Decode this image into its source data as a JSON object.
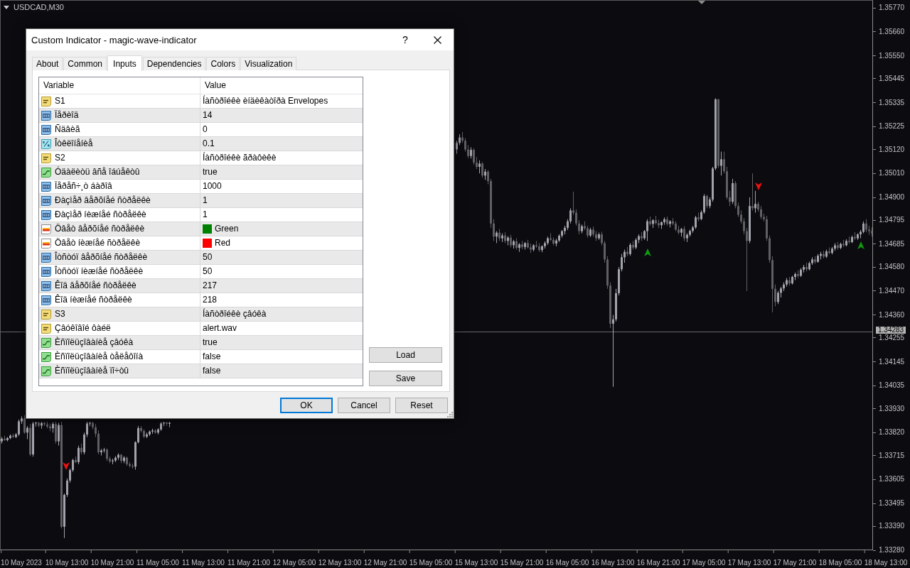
{
  "chart": {
    "symbol": "USDCAD,M30",
    "chart_data": {
      "type": "candlestick",
      "ylim": [
        1.3328,
        1.35806
      ],
      "yticks": [
        {
          "value": 1.3577,
          "label": "1.35770"
        },
        {
          "value": 1.3566,
          "label": "1.35660"
        },
        {
          "value": 1.3555,
          "label": "1.35550"
        },
        {
          "value": 1.35445,
          "label": "1.35445"
        },
        {
          "value": 1.35335,
          "label": "1.35335"
        },
        {
          "value": 1.35225,
          "label": "1.35225"
        },
        {
          "value": 1.3512,
          "label": "1.35120"
        },
        {
          "value": 1.3501,
          "label": "1.35010"
        },
        {
          "value": 1.349,
          "label": "1.34900"
        },
        {
          "value": 1.34795,
          "label": "1.34795"
        },
        {
          "value": 1.34685,
          "label": "1.34685"
        },
        {
          "value": 1.3458,
          "label": "1.34580"
        },
        {
          "value": 1.3447,
          "label": "1.34470"
        },
        {
          "value": 1.3436,
          "label": "1.34360"
        },
        {
          "value": 1.34255,
          "label": "1.34255"
        },
        {
          "value": 1.34145,
          "label": "1.34145"
        },
        {
          "value": 1.34035,
          "label": "1.34035"
        },
        {
          "value": 1.3393,
          "label": "1.33930"
        },
        {
          "value": 1.3382,
          "label": "1.33820"
        },
        {
          "value": 1.33715,
          "label": "1.33715"
        },
        {
          "value": 1.33605,
          "label": "1.33605"
        },
        {
          "value": 1.33495,
          "label": "1.33495"
        },
        {
          "value": 1.3339,
          "label": "1.33390"
        },
        {
          "value": 1.3328,
          "label": "1.33280"
        }
      ],
      "ref_lines": [
        {
          "axis": "y",
          "value": 1.34283,
          "label": "1.34283"
        }
      ],
      "categories": [
        null,
        null,
        null,
        null,
        null,
        null,
        null,
        "10 May 2023",
        null,
        null,
        null,
        null,
        null,
        null,
        null,
        null,
        null,
        null,
        null,
        null,
        null,
        null,
        null,
        "10 May 13:00",
        null,
        null,
        null,
        null,
        null,
        null,
        null,
        null,
        null,
        null,
        null,
        null,
        null,
        null,
        null,
        "10 May 21:00",
        null,
        null,
        null,
        null,
        null,
        null,
        null,
        null,
        null,
        null,
        null,
        null,
        null,
        null,
        null,
        "11 May 05:00",
        null,
        null,
        null,
        null,
        null,
        null,
        null,
        null,
        null,
        null,
        null,
        null,
        null,
        null,
        null,
        "11 May 13:00",
        null,
        null,
        null,
        null,
        null,
        null,
        null,
        null,
        null,
        null,
        null,
        null,
        null,
        null,
        null,
        "11 May 21:00",
        null,
        null,
        null,
        null,
        null,
        null,
        null,
        null,
        null,
        null,
        null,
        null,
        null,
        null,
        null,
        "12 May 05:00",
        null,
        null,
        null,
        null,
        null,
        null,
        null,
        null,
        null,
        null,
        null,
        null,
        null,
        null,
        null,
        "12 May 13:00",
        null,
        null,
        null,
        null,
        null,
        null,
        null,
        null,
        null,
        null,
        null,
        null,
        null,
        null,
        null,
        "12 May 21:00",
        null,
        null,
        null,
        null,
        null,
        null,
        null,
        null,
        null,
        null,
        null,
        null,
        null,
        null,
        null,
        "15 May 05:00",
        null,
        null,
        null,
        null,
        null,
        null,
        null,
        null,
        null,
        null,
        null,
        null,
        null,
        null,
        null,
        "15 May 13:00",
        null,
        null,
        null,
        null,
        null,
        null,
        null,
        null,
        null,
        null,
        null,
        null,
        null,
        null,
        null,
        "15 May 21:00",
        null,
        null,
        null,
        null,
        null,
        null,
        null,
        null,
        null,
        null,
        null,
        null,
        null,
        null,
        null,
        "16 May 05:00",
        null,
        null,
        null,
        null,
        null,
        null,
        null,
        null,
        null,
        null,
        null,
        null,
        null,
        null,
        null,
        "16 May 13:00",
        null,
        null,
        null,
        null,
        null,
        null,
        null,
        null,
        null,
        null,
        null,
        null,
        null,
        null,
        null,
        "16 May 21:00",
        null,
        null,
        null,
        null,
        null,
        null,
        null,
        null,
        null,
        null,
        null,
        null,
        null,
        null,
        null,
        "17 May 05:00",
        null,
        null,
        null,
        null,
        null,
        null,
        null,
        null,
        null,
        null,
        null,
        null,
        null,
        null,
        null,
        "17 May 13:00",
        null,
        null,
        null,
        null,
        null,
        null,
        null,
        null,
        null,
        null,
        null,
        null,
        null,
        null,
        null,
        "17 May 21:00",
        null,
        null,
        null,
        null,
        null,
        null,
        null,
        null,
        null,
        null,
        null,
        null,
        null,
        null,
        null,
        "18 May 05:00",
        null,
        null,
        null,
        null,
        null,
        null,
        null,
        null,
        null,
        null,
        null,
        null,
        null,
        null,
        null,
        "18 May 13:00",
        null,
        null
      ],
      "ohlc": [
        [
          1.3378,
          1.338,
          1.3377,
          1.33792
        ],
        [
          1.33792,
          1.33805,
          1.33782,
          1.33786
        ],
        [
          1.33786,
          1.338,
          1.3378,
          1.33795
        ],
        [
          1.33795,
          1.33812,
          1.3379,
          1.33806
        ],
        [
          1.33806,
          1.33815,
          1.33796,
          1.338
        ],
        [
          1.338,
          1.33818,
          1.33795,
          1.33812
        ],
        [
          1.33812,
          1.3388,
          1.33805,
          1.33872
        ],
        [
          1.33872,
          1.33895,
          1.3386,
          1.33885
        ],
        [
          1.33885,
          1.339,
          1.33815,
          1.3382
        ],
        [
          1.3382,
          1.3385,
          1.3379,
          1.33842
        ],
        [
          1.33842,
          1.3386,
          1.33712,
          1.3372
        ],
        [
          1.3372,
          1.3387,
          1.3371,
          1.33862
        ],
        [
          1.33862,
          1.3387,
          1.33848,
          1.33866
        ],
        [
          1.33866,
          1.3387,
          1.33845,
          1.33852
        ],
        [
          1.33852,
          1.3387,
          1.33838,
          1.33864
        ],
        [
          1.33864,
          1.3387,
          1.3385,
          1.33858
        ],
        [
          1.33858,
          1.3387,
          1.3384,
          1.33848
        ],
        [
          1.33848,
          1.33862,
          1.33826,
          1.3384
        ],
        [
          1.3384,
          1.33868,
          1.3382,
          1.3386
        ],
        [
          1.3386,
          1.3387,
          1.3377,
          1.3378
        ],
        [
          1.3378,
          1.33865,
          1.3376,
          1.33855
        ],
        [
          1.33855,
          1.3387,
          1.3338,
          1.33388
        ],
        [
          1.33388,
          1.3354,
          1.33336,
          1.33534
        ],
        [
          1.33534,
          1.3361,
          1.33525,
          1.336
        ],
        [
          1.336,
          1.33655,
          1.3359,
          1.33648
        ],
        [
          1.33648,
          1.337,
          1.3364,
          1.33694
        ],
        [
          1.33694,
          1.3371,
          1.3368,
          1.33685
        ],
        [
          1.33685,
          1.3376,
          1.33675,
          1.3375
        ],
        [
          1.3375,
          1.3377,
          1.3372,
          1.3373
        ],
        [
          1.3373,
          1.3382,
          1.3372,
          1.33811
        ],
        [
          1.33811,
          1.3387,
          1.338,
          1.33862
        ],
        [
          1.33862,
          1.3387,
          1.3385,
          1.33865
        ],
        [
          1.33865,
          1.3387,
          1.33835,
          1.33845
        ],
        [
          1.33845,
          1.3386,
          1.338,
          1.33815
        ],
        [
          1.33815,
          1.3383,
          1.3372,
          1.3373
        ],
        [
          1.3373,
          1.33745,
          1.33715,
          1.33738
        ],
        [
          1.33738,
          1.3375,
          1.33728,
          1.33742
        ],
        [
          1.33742,
          1.33748,
          1.3369,
          1.337
        ],
        [
          1.337,
          1.3371,
          1.3368,
          1.33688
        ],
        [
          1.33688,
          1.337,
          1.33675,
          1.33692
        ],
        [
          1.33692,
          1.33712,
          1.33685,
          1.33705
        ],
        [
          1.33705,
          1.33725,
          1.33695,
          1.33718
        ],
        [
          1.33718,
          1.33722,
          1.3368,
          1.3369
        ],
        [
          1.3369,
          1.33712,
          1.3368,
          1.33705
        ],
        [
          1.33705,
          1.3371,
          1.33668,
          1.33675
        ],
        [
          1.33675,
          1.33685,
          1.3366,
          1.33668
        ],
        [
          1.33668,
          1.33678,
          1.33655,
          1.33664
        ],
        [
          1.33664,
          1.3378,
          1.3365,
          1.33776
        ],
        [
          1.33776,
          1.3385,
          1.3377,
          1.33841
        ],
        [
          1.33841,
          1.3385,
          1.3382,
          1.33828
        ],
        [
          1.33828,
          1.33835,
          1.33795,
          1.33802
        ],
        [
          1.33802,
          1.3382,
          1.33795,
          1.33812
        ],
        [
          1.33812,
          1.3383,
          1.33805,
          1.33825
        ],
        [
          1.33825,
          1.33838,
          1.33815,
          1.3383
        ],
        [
          1.3383,
          1.33836,
          1.33815,
          1.3382
        ],
        [
          1.3382,
          1.3384,
          1.33812,
          1.33835
        ],
        [
          1.33835,
          1.33868,
          1.33828,
          1.33862
        ],
        [
          1.33862,
          1.3387,
          1.3385,
          1.33866
        ],
        [
          1.33866,
          1.3387,
          1.33852,
          1.3386
        ],
        [
          1.3386,
          1.3387,
          1.33845,
          1.33865
        ],
        null,
        null,
        null,
        null,
        null,
        null,
        null,
        null,
        null,
        null,
        null,
        null,
        null,
        null,
        null,
        null,
        null,
        null,
        null,
        null,
        null,
        null,
        null,
        null,
        null,
        null,
        null,
        null,
        null,
        null,
        null,
        null,
        null,
        null,
        null,
        null,
        null,
        null,
        null,
        null,
        null,
        null,
        null,
        null,
        null,
        null,
        null,
        null,
        null,
        null,
        null,
        null,
        null,
        null,
        null,
        null,
        null,
        null,
        null,
        null,
        null,
        null,
        null,
        null,
        null,
        null,
        null,
        null,
        null,
        null,
        null,
        null,
        null,
        null,
        null,
        null,
        null,
        null,
        null,
        null,
        null,
        null,
        null,
        null,
        null,
        null,
        null,
        null,
        null,
        null,
        null,
        null,
        null,
        null,
        null,
        null,
        null,
        null,
        null,
        null,
        [
          1.3512,
          1.3516,
          1.351,
          1.3515
        ],
        [
          1.3515,
          1.3519,
          1.3514,
          1.35175
        ],
        [
          1.35175,
          1.352,
          1.3515,
          1.3516
        ],
        [
          1.3516,
          1.35172,
          1.3511,
          1.3512
        ],
        [
          1.3512,
          1.3514,
          1.3508,
          1.3509
        ],
        [
          1.3509,
          1.3513,
          1.35078,
          1.35118
        ],
        [
          1.35118,
          1.35125,
          1.3505,
          1.3506
        ],
        [
          1.3506,
          1.35085,
          1.3503,
          1.3504
        ],
        [
          1.3504,
          1.3507,
          1.3501,
          1.35055
        ],
        [
          1.35055,
          1.35062,
          1.3499,
          1.35
        ],
        [
          1.35,
          1.3503,
          1.3498,
          1.35018
        ],
        [
          1.35018,
          1.35025,
          1.3496,
          1.34975
        ],
        [
          1.34975,
          1.34985,
          1.3476,
          1.3478
        ],
        [
          1.3478,
          1.348,
          1.347,
          1.3472
        ],
        [
          1.3472,
          1.34745,
          1.3469,
          1.34738
        ],
        [
          1.34738,
          1.34755,
          1.347,
          1.34712
        ],
        [
          1.34712,
          1.34735,
          1.34695,
          1.34725
        ],
        [
          1.34725,
          1.3474,
          1.3469,
          1.347
        ],
        [
          1.347,
          1.34722,
          1.3468,
          1.34715
        ],
        [
          1.34715,
          1.34728,
          1.3467,
          1.3468
        ],
        [
          1.3468,
          1.34705,
          1.34665,
          1.34698
        ],
        [
          1.34698,
          1.34712,
          1.3466,
          1.34668
        ],
        [
          1.34668,
          1.3469,
          1.3465,
          1.34684
        ],
        [
          1.34684,
          1.347,
          1.34662,
          1.34672
        ],
        [
          1.34672,
          1.34695,
          1.3466,
          1.3469
        ],
        [
          1.3469,
          1.34705,
          1.34665,
          1.3467
        ],
        [
          1.3467,
          1.34688,
          1.34645,
          1.3466
        ],
        [
          1.3466,
          1.34685,
          1.34652,
          1.3468
        ],
        [
          1.3468,
          1.347,
          1.34668,
          1.34675
        ],
        [
          1.34675,
          1.3469,
          1.3465,
          1.34658
        ],
        [
          1.34658,
          1.3468,
          1.34648,
          1.34676
        ],
        [
          1.34676,
          1.34698,
          1.34665,
          1.3469
        ],
        [
          1.3469,
          1.3472,
          1.34682,
          1.34712
        ],
        [
          1.34712,
          1.34735,
          1.347,
          1.34705
        ],
        [
          1.34705,
          1.34716,
          1.3468,
          1.34688
        ],
        [
          1.34688,
          1.3471,
          1.34675,
          1.34702
        ],
        [
          1.34702,
          1.3473,
          1.34695,
          1.34724
        ],
        [
          1.34724,
          1.3475,
          1.34715,
          1.34745
        ],
        [
          1.34745,
          1.3477,
          1.3473,
          1.3476
        ],
        [
          1.3476,
          1.348,
          1.3475,
          1.3479
        ],
        [
          1.3479,
          1.3485,
          1.3478,
          1.3484
        ],
        [
          1.3484,
          1.34926,
          1.3482,
          1.3483
        ],
        [
          1.3483,
          1.34845,
          1.3477,
          1.3478
        ],
        [
          1.3478,
          1.34795,
          1.3473,
          1.34745
        ],
        [
          1.34745,
          1.34775,
          1.34735,
          1.34768
        ],
        [
          1.34768,
          1.3479,
          1.3475,
          1.34758
        ],
        [
          1.34758,
          1.3477,
          1.34715,
          1.34725
        ],
        [
          1.34725,
          1.3476,
          1.34718,
          1.34752
        ],
        [
          1.34752,
          1.34766,
          1.3472,
          1.3473
        ],
        [
          1.3473,
          1.34745,
          1.347,
          1.34712
        ],
        [
          1.34712,
          1.34738,
          1.34705,
          1.3473
        ],
        [
          1.3473,
          1.34742,
          1.3468,
          1.3469
        ],
        [
          1.3469,
          1.347,
          1.346,
          1.34615
        ],
        [
          1.34615,
          1.3463,
          1.3448,
          1.34495
        ],
        [
          1.34495,
          1.3451,
          1.343,
          1.3432
        ],
        [
          1.3432,
          1.3436,
          1.3403,
          1.3434
        ],
        [
          1.3434,
          1.3448,
          1.3433,
          1.3446
        ],
        [
          1.3446,
          1.3458,
          1.3445,
          1.3457
        ],
        [
          1.3457,
          1.3464,
          1.3456,
          1.34625
        ],
        [
          1.34625,
          1.3466,
          1.346,
          1.3465
        ],
        [
          1.3465,
          1.34672,
          1.3463,
          1.3464
        ],
        [
          1.3464,
          1.3469,
          1.34632,
          1.34682
        ],
        [
          1.34682,
          1.347,
          1.3466,
          1.3467
        ],
        [
          1.3467,
          1.34712,
          1.34662,
          1.34705
        ],
        [
          1.34705,
          1.3473,
          1.3469,
          1.34722
        ],
        [
          1.34722,
          1.3474,
          1.347,
          1.34712
        ],
        [
          1.34712,
          1.3475,
          1.34705,
          1.34745
        ],
        [
          1.34745,
          1.348,
          1.347,
          1.3479
        ],
        [
          1.3479,
          1.34812,
          1.3477,
          1.34778
        ],
        [
          1.34778,
          1.348,
          1.3476,
          1.34795
        ],
        [
          1.34795,
          1.34815,
          1.34775,
          1.34782
        ],
        [
          1.34782,
          1.34798,
          1.3476,
          1.34772
        ],
        [
          1.34772,
          1.3479,
          1.34755,
          1.34786
        ],
        [
          1.34786,
          1.34808,
          1.34774,
          1.348
        ],
        [
          1.348,
          1.34812,
          1.3477,
          1.34778
        ],
        [
          1.34778,
          1.34795,
          1.34762,
          1.3479
        ],
        [
          1.3479,
          1.34805,
          1.34772,
          1.3478
        ],
        [
          1.3478,
          1.3479,
          1.34745,
          1.34752
        ],
        [
          1.34752,
          1.3477,
          1.3473,
          1.34738
        ],
        [
          1.34738,
          1.3476,
          1.3472,
          1.34755
        ],
        [
          1.34755,
          1.34768,
          1.347,
          1.34712
        ],
        [
          1.34712,
          1.34735,
          1.34695,
          1.34728
        ],
        [
          1.34728,
          1.34752,
          1.3472,
          1.34746
        ],
        [
          1.34746,
          1.3477,
          1.34738,
          1.34762
        ],
        [
          1.34762,
          1.34815,
          1.34755,
          1.34808
        ],
        [
          1.34808,
          1.3483,
          1.3479,
          1.348
        ],
        [
          1.348,
          1.3484,
          1.34795,
          1.34832
        ],
        [
          1.34832,
          1.34915,
          1.34825,
          1.34906
        ],
        [
          1.34906,
          1.34912,
          1.3485,
          1.3486
        ],
        [
          1.3486,
          1.349,
          1.3485,
          1.3489
        ],
        [
          1.3489,
          1.3504,
          1.3488,
          1.35033
        ],
        [
          1.35033,
          1.35355,
          1.35025,
          1.3535
        ],
        [
          1.3535,
          1.35352,
          1.35035,
          1.35045
        ],
        [
          1.35045,
          1.3511,
          1.35,
          1.35075
        ],
        [
          1.35075,
          1.3511,
          1.3501,
          1.3502
        ],
        [
          1.3502,
          1.3504,
          1.3489,
          1.349
        ],
        [
          1.349,
          1.3493,
          1.3486,
          1.3488
        ],
        [
          1.3488,
          1.34985,
          1.3487,
          1.34965
        ],
        [
          1.34965,
          1.34975,
          1.3485,
          1.3486
        ],
        [
          1.3486,
          1.34875,
          1.3481,
          1.3482
        ],
        [
          1.3482,
          1.3484,
          1.3478,
          1.3479
        ],
        [
          1.3479,
          1.34805,
          1.3473,
          1.34745
        ],
        [
          1.34745,
          1.3476,
          1.3447,
          1.347
        ],
        [
          1.347,
          1.349,
          1.3469,
          1.3486
        ],
        [
          1.3486,
          1.3501,
          1.3484,
          1.3485
        ],
        [
          1.3485,
          1.3493,
          1.3483,
          1.3487
        ],
        [
          1.3487,
          1.3488,
          1.34835,
          1.34845
        ],
        [
          1.34845,
          1.3486,
          1.348,
          1.3481
        ],
        [
          1.3481,
          1.34825,
          1.3479,
          1.348
        ],
        [
          1.348,
          1.34815,
          1.347,
          1.34712
        ],
        [
          1.34712,
          1.34725,
          1.346,
          1.34612
        ],
        [
          1.34612,
          1.3463,
          1.34372,
          1.3448
        ],
        [
          1.3448,
          1.345,
          1.344,
          1.3442
        ],
        [
          1.3442,
          1.3447,
          1.3441,
          1.34462
        ],
        [
          1.34462,
          1.3449,
          1.3444,
          1.34482
        ],
        [
          1.34482,
          1.3451,
          1.3447,
          1.345
        ],
        [
          1.345,
          1.3453,
          1.3449,
          1.3452
        ],
        [
          1.3452,
          1.34535,
          1.34495,
          1.34505
        ],
        [
          1.34505,
          1.3454,
          1.345,
          1.34535
        ],
        [
          1.34535,
          1.34555,
          1.3452,
          1.34548
        ],
        [
          1.34548,
          1.34565,
          1.3453,
          1.3454
        ],
        [
          1.3454,
          1.34575,
          1.34535,
          1.34568
        ],
        [
          1.34568,
          1.3459,
          1.34555,
          1.3458
        ],
        [
          1.3458,
          1.346,
          1.3456,
          1.3457
        ],
        [
          1.3457,
          1.34605,
          1.34565,
          1.34598
        ],
        [
          1.34598,
          1.34625,
          1.3459,
          1.34615
        ],
        [
          1.34615,
          1.3463,
          1.34595,
          1.34604
        ],
        [
          1.34604,
          1.3464,
          1.346,
          1.34632
        ],
        [
          1.34632,
          1.3465,
          1.34615,
          1.3464
        ],
        [
          1.3464,
          1.34655,
          1.3462,
          1.34628
        ],
        [
          1.34628,
          1.3466,
          1.34622,
          1.34652
        ],
        [
          1.34652,
          1.3467,
          1.3464,
          1.34645
        ],
        [
          1.34645,
          1.34672,
          1.34638,
          1.34665
        ],
        [
          1.34665,
          1.3469,
          1.34655,
          1.3468
        ],
        [
          1.3468,
          1.34695,
          1.3466,
          1.34668
        ],
        [
          1.34668,
          1.34692,
          1.34662,
          1.34686
        ],
        [
          1.34686,
          1.34705,
          1.34672,
          1.3468
        ],
        [
          1.3468,
          1.34708,
          1.34675,
          1.347
        ],
        [
          1.347,
          1.3472,
          1.34688,
          1.34695
        ],
        [
          1.34695,
          1.34725,
          1.3469,
          1.34718
        ],
        [
          1.34718,
          1.3474,
          1.34705,
          1.34712
        ],
        [
          1.34712,
          1.34735,
          1.34705,
          1.3473
        ],
        [
          1.3473,
          1.3475,
          1.34712,
          1.34742
        ],
        [
          1.34742,
          1.3479,
          1.34735,
          1.3478
        ],
        [
          1.3478,
          1.348,
          1.3474,
          1.34752
        ],
        [
          1.34752,
          1.3477,
          1.34728,
          1.34745
        ],
        [
          1.34745,
          1.34762,
          1.3472,
          1.34735
        ],
        null,
        null,
        null,
        null,
        null,
        null,
        null
      ]
    }
  },
  "dialog": {
    "title": "Custom Indicator - magic-wave-indicator",
    "help": "?",
    "tabs": [
      {
        "label": "About",
        "selected": false
      },
      {
        "label": "Common",
        "selected": false
      },
      {
        "label": "Inputs",
        "selected": true
      },
      {
        "label": "Dependencies",
        "selected": false
      },
      {
        "label": "Colors",
        "selected": false
      },
      {
        "label": "Visualization",
        "selected": false
      }
    ],
    "table": {
      "columns": [
        "Variable",
        "Value"
      ],
      "rows": [
        {
          "kind": "string",
          "name": "S1",
          "value": "Íàñòðîéêè èíäèêàòîðà Envelopes"
        },
        {
          "kind": "int",
          "name": "Ïåðèîä",
          "value": "14"
        },
        {
          "kind": "int",
          "name": "Ñäâèã",
          "value": "0"
        },
        {
          "kind": "double",
          "name": "Îòêëîíåíèå",
          "value": "0.1"
        },
        {
          "kind": "string",
          "name": "S2",
          "value": "Íàñòðîéêè ãðàôèêè"
        },
        {
          "kind": "bool",
          "name": "Óäàëèòü âñå îáúåêòû",
          "value": "true"
        },
        {
          "kind": "int",
          "name": "Ïåðåñ÷¸ò áàðîâ",
          "value": "1000"
        },
        {
          "kind": "int",
          "name": "Ðàçìåð âåðõíåé ñòðåëêè",
          "value": "1"
        },
        {
          "kind": "int",
          "name": "Ðàçìåð íèæíåé ñòðåëêè",
          "value": "1"
        },
        {
          "kind": "color",
          "name": "Öâåò âåðõíåé ñòðåëêè",
          "value": "Green",
          "color": "#008000"
        },
        {
          "kind": "color",
          "name": "Öâåò íèæíåé ñòðåëêè",
          "value": "Red",
          "color": "#ff0000"
        },
        {
          "kind": "int",
          "name": "Îòñòóï âåðõíåé ñòðåëêè",
          "value": "50"
        },
        {
          "kind": "int",
          "name": "Îòñòóï íèæíåé ñòðåëêè",
          "value": "50"
        },
        {
          "kind": "int",
          "name": "Êîä âåðõíåé ñòðåëêè",
          "value": "217"
        },
        {
          "kind": "int",
          "name": "Êîä íèæíåé ñòðåëêè",
          "value": "218"
        },
        {
          "kind": "string",
          "name": "S3",
          "value": "Íàñòðîéêè çâóêà"
        },
        {
          "kind": "string",
          "name": "Çâóêîâîé ôàéë",
          "value": "alert.wav"
        },
        {
          "kind": "bool",
          "name": "Èñïîëüçîâàíèå çâóêà",
          "value": "true"
        },
        {
          "kind": "bool",
          "name": "Èñïîëüçîâàíèå òåëåôîíà",
          "value": "false"
        },
        {
          "kind": "bool",
          "name": "Èñïîëüçîâàíèå ïî÷òû",
          "value": "false"
        }
      ]
    },
    "side_buttons": [
      "Load",
      "Save"
    ],
    "buttons": [
      {
        "label": "OK",
        "default": true
      },
      {
        "label": "Cancel",
        "default": false
      },
      {
        "label": "Reset",
        "default": false
      }
    ]
  }
}
